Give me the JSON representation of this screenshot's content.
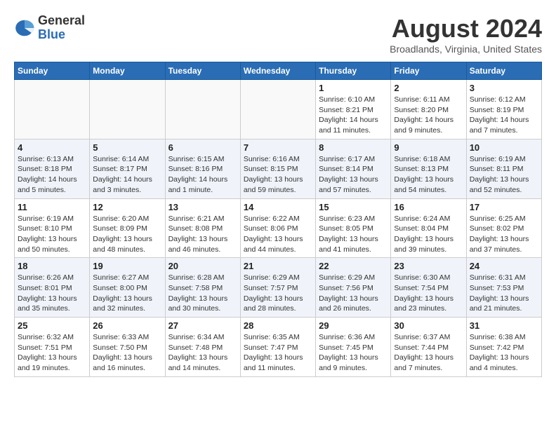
{
  "logo": {
    "general": "General",
    "blue": "Blue"
  },
  "title": "August 2024",
  "location": "Broadlands, Virginia, United States",
  "days_of_week": [
    "Sunday",
    "Monday",
    "Tuesday",
    "Wednesday",
    "Thursday",
    "Friday",
    "Saturday"
  ],
  "weeks": [
    {
      "alt": false,
      "days": [
        {
          "num": "",
          "info": ""
        },
        {
          "num": "",
          "info": ""
        },
        {
          "num": "",
          "info": ""
        },
        {
          "num": "",
          "info": ""
        },
        {
          "num": "1",
          "info": "Sunrise: 6:10 AM\nSunset: 8:21 PM\nDaylight: 14 hours\nand 11 minutes."
        },
        {
          "num": "2",
          "info": "Sunrise: 6:11 AM\nSunset: 8:20 PM\nDaylight: 14 hours\nand 9 minutes."
        },
        {
          "num": "3",
          "info": "Sunrise: 6:12 AM\nSunset: 8:19 PM\nDaylight: 14 hours\nand 7 minutes."
        }
      ]
    },
    {
      "alt": true,
      "days": [
        {
          "num": "4",
          "info": "Sunrise: 6:13 AM\nSunset: 8:18 PM\nDaylight: 14 hours\nand 5 minutes."
        },
        {
          "num": "5",
          "info": "Sunrise: 6:14 AM\nSunset: 8:17 PM\nDaylight: 14 hours\nand 3 minutes."
        },
        {
          "num": "6",
          "info": "Sunrise: 6:15 AM\nSunset: 8:16 PM\nDaylight: 14 hours\nand 1 minute."
        },
        {
          "num": "7",
          "info": "Sunrise: 6:16 AM\nSunset: 8:15 PM\nDaylight: 13 hours\nand 59 minutes."
        },
        {
          "num": "8",
          "info": "Sunrise: 6:17 AM\nSunset: 8:14 PM\nDaylight: 13 hours\nand 57 minutes."
        },
        {
          "num": "9",
          "info": "Sunrise: 6:18 AM\nSunset: 8:13 PM\nDaylight: 13 hours\nand 54 minutes."
        },
        {
          "num": "10",
          "info": "Sunrise: 6:19 AM\nSunset: 8:11 PM\nDaylight: 13 hours\nand 52 minutes."
        }
      ]
    },
    {
      "alt": false,
      "days": [
        {
          "num": "11",
          "info": "Sunrise: 6:19 AM\nSunset: 8:10 PM\nDaylight: 13 hours\nand 50 minutes."
        },
        {
          "num": "12",
          "info": "Sunrise: 6:20 AM\nSunset: 8:09 PM\nDaylight: 13 hours\nand 48 minutes."
        },
        {
          "num": "13",
          "info": "Sunrise: 6:21 AM\nSunset: 8:08 PM\nDaylight: 13 hours\nand 46 minutes."
        },
        {
          "num": "14",
          "info": "Sunrise: 6:22 AM\nSunset: 8:06 PM\nDaylight: 13 hours\nand 44 minutes."
        },
        {
          "num": "15",
          "info": "Sunrise: 6:23 AM\nSunset: 8:05 PM\nDaylight: 13 hours\nand 41 minutes."
        },
        {
          "num": "16",
          "info": "Sunrise: 6:24 AM\nSunset: 8:04 PM\nDaylight: 13 hours\nand 39 minutes."
        },
        {
          "num": "17",
          "info": "Sunrise: 6:25 AM\nSunset: 8:02 PM\nDaylight: 13 hours\nand 37 minutes."
        }
      ]
    },
    {
      "alt": true,
      "days": [
        {
          "num": "18",
          "info": "Sunrise: 6:26 AM\nSunset: 8:01 PM\nDaylight: 13 hours\nand 35 minutes."
        },
        {
          "num": "19",
          "info": "Sunrise: 6:27 AM\nSunset: 8:00 PM\nDaylight: 13 hours\nand 32 minutes."
        },
        {
          "num": "20",
          "info": "Sunrise: 6:28 AM\nSunset: 7:58 PM\nDaylight: 13 hours\nand 30 minutes."
        },
        {
          "num": "21",
          "info": "Sunrise: 6:29 AM\nSunset: 7:57 PM\nDaylight: 13 hours\nand 28 minutes."
        },
        {
          "num": "22",
          "info": "Sunrise: 6:29 AM\nSunset: 7:56 PM\nDaylight: 13 hours\nand 26 minutes."
        },
        {
          "num": "23",
          "info": "Sunrise: 6:30 AM\nSunset: 7:54 PM\nDaylight: 13 hours\nand 23 minutes."
        },
        {
          "num": "24",
          "info": "Sunrise: 6:31 AM\nSunset: 7:53 PM\nDaylight: 13 hours\nand 21 minutes."
        }
      ]
    },
    {
      "alt": false,
      "days": [
        {
          "num": "25",
          "info": "Sunrise: 6:32 AM\nSunset: 7:51 PM\nDaylight: 13 hours\nand 19 minutes."
        },
        {
          "num": "26",
          "info": "Sunrise: 6:33 AM\nSunset: 7:50 PM\nDaylight: 13 hours\nand 16 minutes."
        },
        {
          "num": "27",
          "info": "Sunrise: 6:34 AM\nSunset: 7:48 PM\nDaylight: 13 hours\nand 14 minutes."
        },
        {
          "num": "28",
          "info": "Sunrise: 6:35 AM\nSunset: 7:47 PM\nDaylight: 13 hours\nand 11 minutes."
        },
        {
          "num": "29",
          "info": "Sunrise: 6:36 AM\nSunset: 7:45 PM\nDaylight: 13 hours\nand 9 minutes."
        },
        {
          "num": "30",
          "info": "Sunrise: 6:37 AM\nSunset: 7:44 PM\nDaylight: 13 hours\nand 7 minutes."
        },
        {
          "num": "31",
          "info": "Sunrise: 6:38 AM\nSunset: 7:42 PM\nDaylight: 13 hours\nand 4 minutes."
        }
      ]
    }
  ]
}
